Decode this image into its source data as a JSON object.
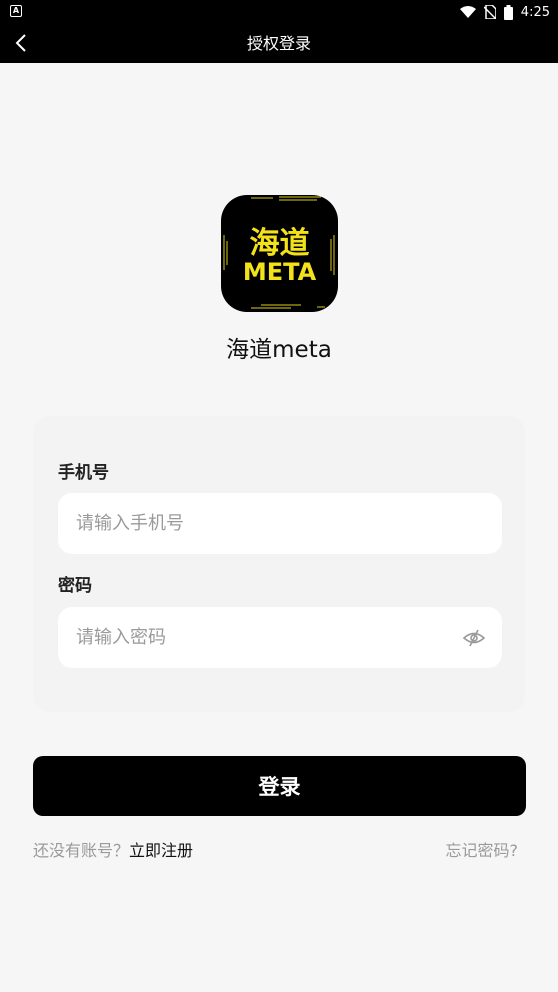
{
  "status_bar": {
    "time": "4:25",
    "notification_icon": "a-notification-icon",
    "icons": [
      "wifi-icon",
      "no-sim-icon",
      "battery-icon"
    ]
  },
  "header": {
    "title": "授权登录",
    "back_icon": "chevron-left-icon"
  },
  "app": {
    "logo_text_top": "海道",
    "logo_text_bottom": "META",
    "logo_accent": "#f3e21a",
    "name": "海道meta"
  },
  "form": {
    "phone": {
      "label": "手机号",
      "placeholder": "请输入手机号",
      "value": ""
    },
    "password": {
      "label": "密码",
      "placeholder": "请输入密码",
      "value": "",
      "toggle_icon": "eye-off-icon"
    }
  },
  "actions": {
    "login_label": "登录",
    "no_account_text": "还没有账号？",
    "register_label": "立即注册",
    "forgot_label": "忘记密码?"
  },
  "colors": {
    "background": "#f6f6f6",
    "primary": "#000000",
    "muted_text": "#9a9a9a"
  }
}
